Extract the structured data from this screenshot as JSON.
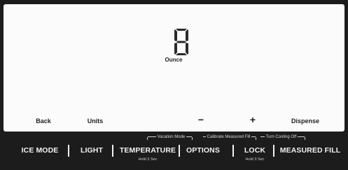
{
  "display": {
    "digit": "8",
    "unit_label": "Ounce"
  },
  "softkeys": {
    "back": "Back",
    "units": "Units",
    "minus": "−",
    "plus": "+",
    "dispense": "Dispense"
  },
  "hold_labels": {
    "vacation_mode": "Vacation Mode",
    "calibrate": "Calibrate Measured Fill",
    "turn_cooling_off": "Turn Cooling Off"
  },
  "buttons": {
    "ice_mode": "ICE MODE",
    "light": "LIGHT",
    "temperature": "TEMPERATURE",
    "temperature_hold": "Hold 3 Sec",
    "options": "OPTIONS",
    "lock": "LOCK",
    "lock_hold": "Hold 3 Sec",
    "measured_fill": "MEASURED FILL"
  },
  "colors": {
    "bar_background": "#1c1c1c",
    "display_background": "#fbfbfb",
    "segment": "#2a2a2a"
  }
}
